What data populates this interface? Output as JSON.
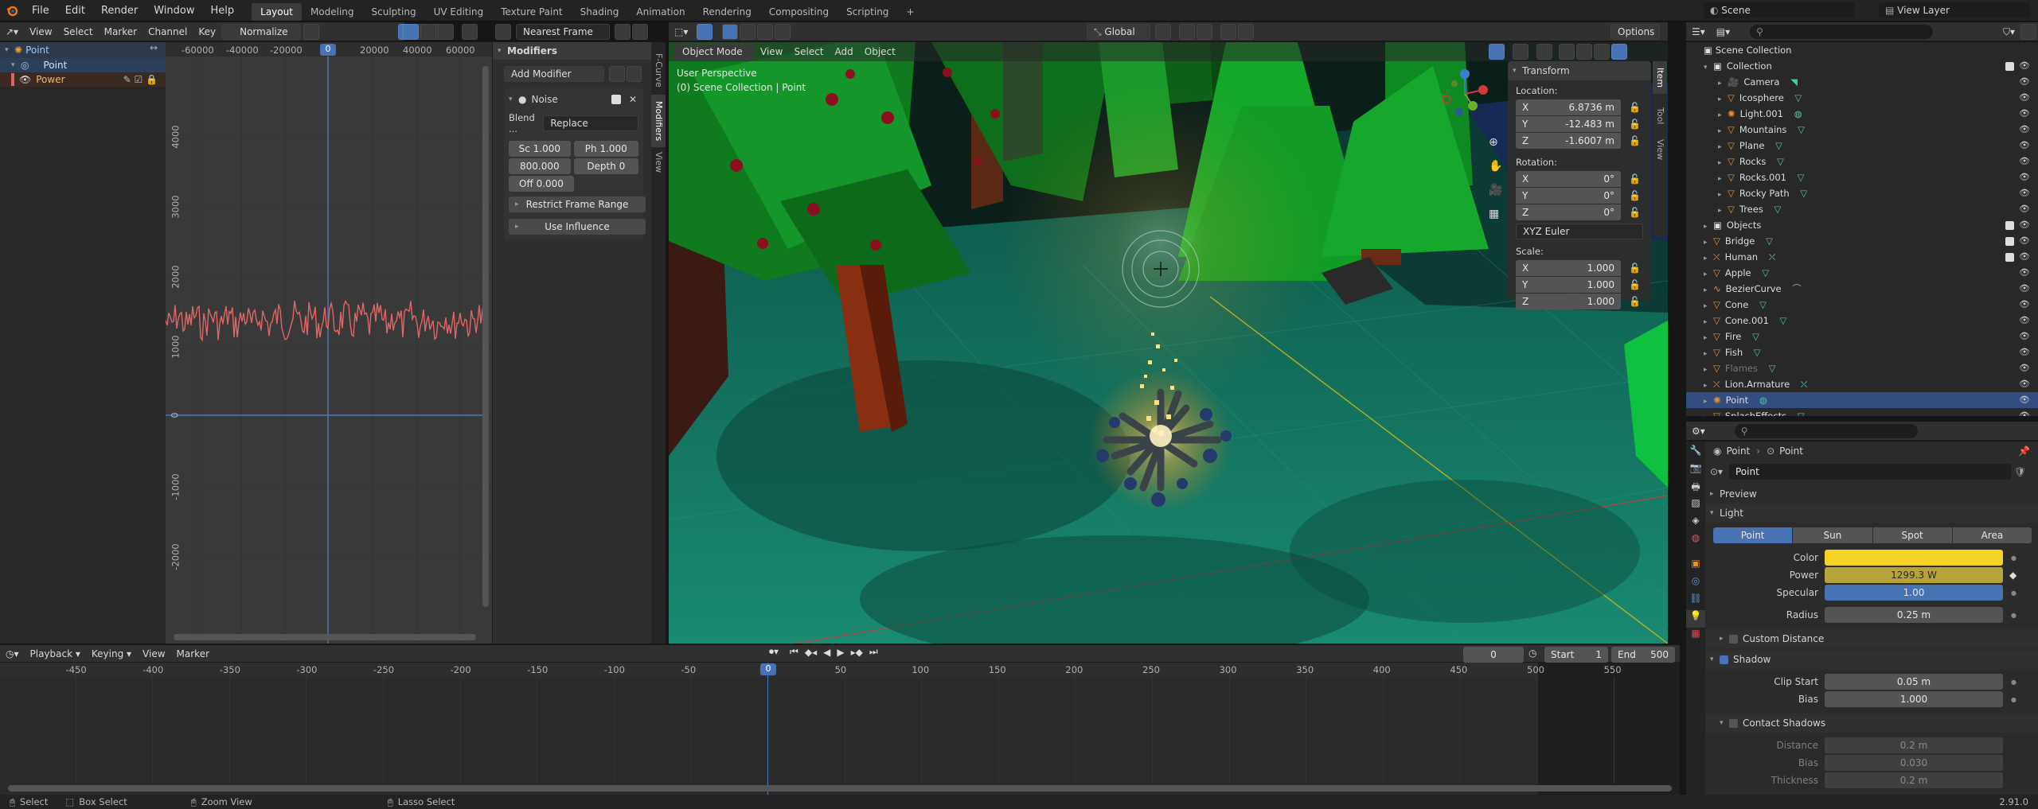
{
  "topbar": {
    "menus": [
      "File",
      "Edit",
      "Render",
      "Window",
      "Help"
    ],
    "workspaces": [
      "Layout",
      "Modeling",
      "Sculpting",
      "UV Editing",
      "Texture Paint",
      "Shading",
      "Animation",
      "Rendering",
      "Compositing",
      "Scripting"
    ],
    "scene": "Scene",
    "view_layer": "View Layer"
  },
  "graph": {
    "menus": [
      "View",
      "Select",
      "Marker",
      "Channel",
      "Key"
    ],
    "normalize": "Normalize",
    "interp": "Nearest Frame",
    "channels": [
      "Point",
      "Point",
      "Power"
    ],
    "xticks": [
      "-60000",
      "-40000",
      "-20000",
      "0",
      "20000",
      "40000",
      "60000"
    ],
    "yticks": [
      "4000",
      "3000",
      "2000",
      "1000",
      "0",
      "-1000",
      "-2000"
    ],
    "modifiers": {
      "title": "Modifiers",
      "add": "Add Modifier",
      "noise": "Noise",
      "blend_label": "Blend ...",
      "blend_value": "Replace",
      "scale": "Sc  1.000",
      "phase": "Ph  1.000",
      "strength": "800.000",
      "depth": "Depth   0",
      "offset": "Off  0.000",
      "restrict": "Restrict Frame Range",
      "influence": "Use Influence"
    },
    "side_tabs": [
      "F-Curve",
      "Modifiers",
      "View"
    ]
  },
  "viewport": {
    "mode": "Object Mode",
    "menus": [
      "View",
      "Select",
      "Add",
      "Object"
    ],
    "orientation": "Global",
    "options": "Options",
    "perspective": "User Perspective",
    "collection": "(0) Scene Collection | Point",
    "side_tabs": [
      "Item",
      "Tool",
      "View"
    ],
    "transform": {
      "title": "Transform",
      "location_label": "Location:",
      "loc": [
        "6.8736 m",
        "-12.483 m",
        "-1.6007 m"
      ],
      "rotation_label": "Rotation:",
      "rot": [
        "0°",
        "0°",
        "0°"
      ],
      "rot_mode": "XYZ Euler",
      "scale_label": "Scale:",
      "scale": [
        "1.000",
        "1.000",
        "1.000"
      ],
      "axes": [
        "X",
        "Y",
        "Z"
      ]
    }
  },
  "outliner": {
    "root": "Scene Collection",
    "items": [
      {
        "label": "Collection",
        "indent": 1,
        "icon": "collection"
      },
      {
        "label": "Camera",
        "indent": 2,
        "icon": "camera"
      },
      {
        "label": "Icosphere",
        "indent": 2,
        "icon": "mesh"
      },
      {
        "label": "Light.001",
        "indent": 2,
        "icon": "light"
      },
      {
        "label": "Mountains",
        "indent": 2,
        "icon": "mesh"
      },
      {
        "label": "Plane",
        "indent": 2,
        "icon": "mesh"
      },
      {
        "label": "Rocks",
        "indent": 2,
        "icon": "mesh"
      },
      {
        "label": "Rocks.001",
        "indent": 2,
        "icon": "mesh"
      },
      {
        "label": "Rocky Path",
        "indent": 2,
        "icon": "mesh"
      },
      {
        "label": "Trees",
        "indent": 2,
        "icon": "mesh"
      },
      {
        "label": "Objects",
        "indent": 1,
        "icon": "collection"
      },
      {
        "label": "Bridge",
        "indent": 1,
        "icon": "mesh"
      },
      {
        "label": "Human",
        "indent": 1,
        "icon": "armature"
      },
      {
        "label": "Apple",
        "indent": 1,
        "icon": "mesh"
      },
      {
        "label": "BezierCurve",
        "indent": 1,
        "icon": "curve"
      },
      {
        "label": "Cone",
        "indent": 1,
        "icon": "mesh"
      },
      {
        "label": "Cone.001",
        "indent": 1,
        "icon": "mesh"
      },
      {
        "label": "Fire",
        "indent": 1,
        "icon": "mesh"
      },
      {
        "label": "Fish",
        "indent": 1,
        "icon": "mesh"
      },
      {
        "label": "Flames",
        "indent": 1,
        "icon": "mesh"
      },
      {
        "label": "Lion.Armature",
        "indent": 1,
        "icon": "armature"
      },
      {
        "label": "Point",
        "indent": 1,
        "icon": "light"
      },
      {
        "label": "SplashEffects",
        "indent": 1,
        "icon": "mesh"
      }
    ]
  },
  "properties": {
    "crumb_a": "Point",
    "crumb_b": "Point",
    "name": "Point",
    "preview": "Preview",
    "light": "Light",
    "types": [
      "Point",
      "Sun",
      "Spot",
      "Area"
    ],
    "color_label": "Color",
    "power_label": "Power",
    "power": "1299.3 W",
    "specular_label": "Specular",
    "specular": "1.00",
    "radius_label": "Radius",
    "radius": "0.25 m",
    "custom_distance": "Custom Distance",
    "shadow": "Shadow",
    "clip_start_label": "Clip Start",
    "clip_start": "0.05 m",
    "bias_label": "Bias",
    "bias": "1.000",
    "contact": "Contact Shadows",
    "distance_label": "Distance",
    "distance": "0.2 m",
    "cbias_label": "Bias",
    "cbias": "0.030",
    "thickness_label": "Thickness",
    "thickness": "0.2 m"
  },
  "timeline": {
    "menus": [
      "Playback",
      "Keying",
      "View",
      "Marker"
    ],
    "frame": "0",
    "start_label": "Start",
    "start": "1",
    "end_label": "End",
    "end": "500",
    "ticks": [
      "-450",
      "-400",
      "-350",
      "-300",
      "-250",
      "-200",
      "-150",
      "-100",
      "-50",
      "0",
      "50",
      "100",
      "150",
      "200",
      "250",
      "300",
      "350",
      "400",
      "450",
      "500",
      "550"
    ]
  },
  "status": {
    "select": "Select",
    "box": "Box Select",
    "zoom": "Zoom View",
    "lasso": "Lasso Select",
    "version": "2.91.0"
  },
  "colors": {
    "accent": "#4772b3",
    "curve": "#e06666",
    "light_color": "#f5d327"
  }
}
